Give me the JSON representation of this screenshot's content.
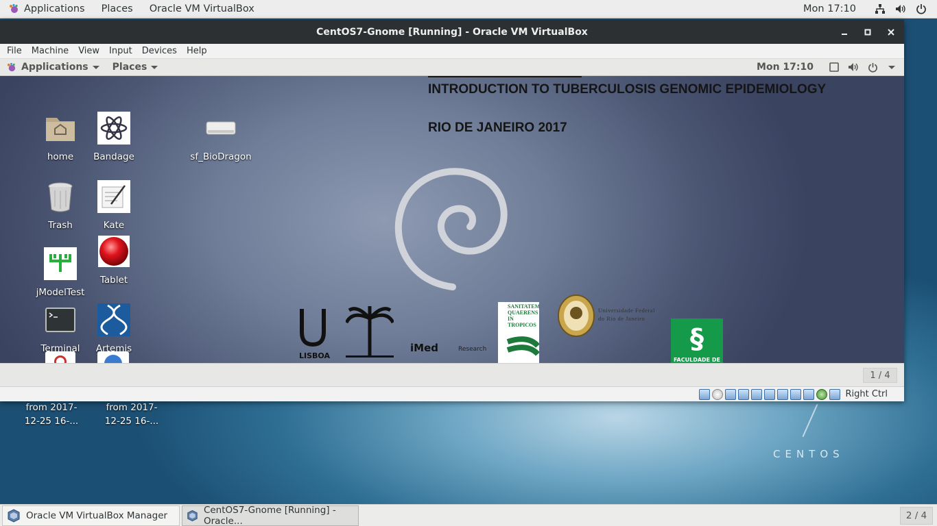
{
  "host_topbar": {
    "applications": "Applications",
    "places": "Places",
    "active_app": "Oracle VM VirtualBox",
    "clock": "Mon 17:10",
    "icons": [
      "network-icon",
      "volume-icon",
      "power-icon"
    ]
  },
  "host_desktop": {
    "icon_labels": [
      "from 2017-\n12-25 16-...",
      "from 2017-\n12-25 16-..."
    ],
    "wordmark": "CENTOS"
  },
  "vbox_window": {
    "title": "CentOS7-Gnome [Running] - Oracle VM VirtualBox",
    "menu": [
      "File",
      "Machine",
      "View",
      "Input",
      "Devices",
      "Help"
    ],
    "host_key": "Right Ctrl"
  },
  "guest_topbar": {
    "applications": "Applications",
    "places": "Places",
    "clock": "Mon 17:10"
  },
  "guest_desktop": {
    "icons": [
      {
        "label": "home",
        "icon": "home-folder-icon"
      },
      {
        "label": "Bandage",
        "icon": "bandage-icon"
      },
      {
        "label": "sf_BioDragon",
        "icon": "drive-icon"
      },
      {
        "label": "Trash",
        "icon": "trash-icon"
      },
      {
        "label": "Kate",
        "icon": "kate-icon"
      },
      {
        "label": "jModelTest",
        "icon": "jmodeltest-icon"
      },
      {
        "label": "Tablet",
        "icon": "tablet-icon"
      },
      {
        "label": "Terminal",
        "icon": "terminal-icon"
      },
      {
        "label": "Artemis",
        "icon": "artemis-icon"
      }
    ],
    "wallpaper_title": "INTRODUCTION TO TUBERCULOSIS GENOMIC EPIDEMIOLOGY",
    "wallpaper_subtitle": "RIO DE JANEIRO 2017",
    "logo_texts": {
      "lisboa": "LISBOA",
      "imed": "iMed",
      "research": "Research",
      "ufrj": "Universidade Federal\ndo Rio de Janeiro",
      "sanitatem": "SANITATEM\nQUAERENS\nIN TROPICOS",
      "faculdade": "FACULDADE DE"
    },
    "workspace": "1 / 4"
  },
  "host_taskbar": {
    "tasks": [
      "Oracle VM VirtualBox Manager",
      "CentOS7-Gnome [Running] - Oracle..."
    ],
    "workspace": "2 / 4"
  },
  "colors": {
    "host_bar": "#ededed",
    "vbox_titlebar": "#2d3032",
    "guest_bg": "#6f7d98"
  }
}
